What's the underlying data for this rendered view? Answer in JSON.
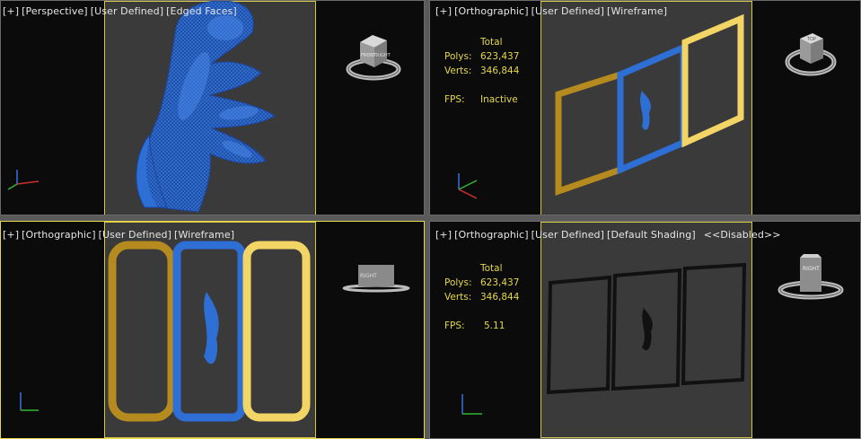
{
  "viewports": [
    {
      "id": "perspective",
      "label": [
        "[+]",
        "[Perspective]",
        "[User Defined]",
        "[Edged Faces]"
      ]
    },
    {
      "id": "ortho-top-right",
      "label": [
        "[+]",
        "[Orthographic]",
        "[User Defined]",
        "[Wireframe]"
      ],
      "stats": {
        "header": "Total",
        "polys_label": "Polys:",
        "polys": "623,437",
        "verts_label": "Verts:",
        "verts": "346,844",
        "fps_label": "FPS:",
        "fps": "Inactive"
      }
    },
    {
      "id": "ortho-bottom-left",
      "label": [
        "[+]",
        "[Orthographic]",
        "[User Defined]",
        "[Wireframe]"
      ]
    },
    {
      "id": "ortho-bottom-right",
      "label": [
        "[+]",
        "[Orthographic]",
        "[User Defined]",
        "[Default Shading]",
        "<<Disabled>>"
      ],
      "stats": {
        "header": "Total",
        "polys_label": "Polys:",
        "polys": "623,437",
        "verts_label": "Verts:",
        "verts": "346,844",
        "fps_label": "FPS:",
        "fps": "5.11"
      }
    }
  ],
  "viewcube_labels": {
    "top": "TOP",
    "front": "FRONT",
    "right": "RIGHT"
  },
  "colors": {
    "frame_gold": "#b58a1e",
    "frame_blue": "#2e6fd6",
    "frame_light": "#f2d565",
    "active_border": "#e8d84a",
    "stats_text": "#e4d84a"
  }
}
